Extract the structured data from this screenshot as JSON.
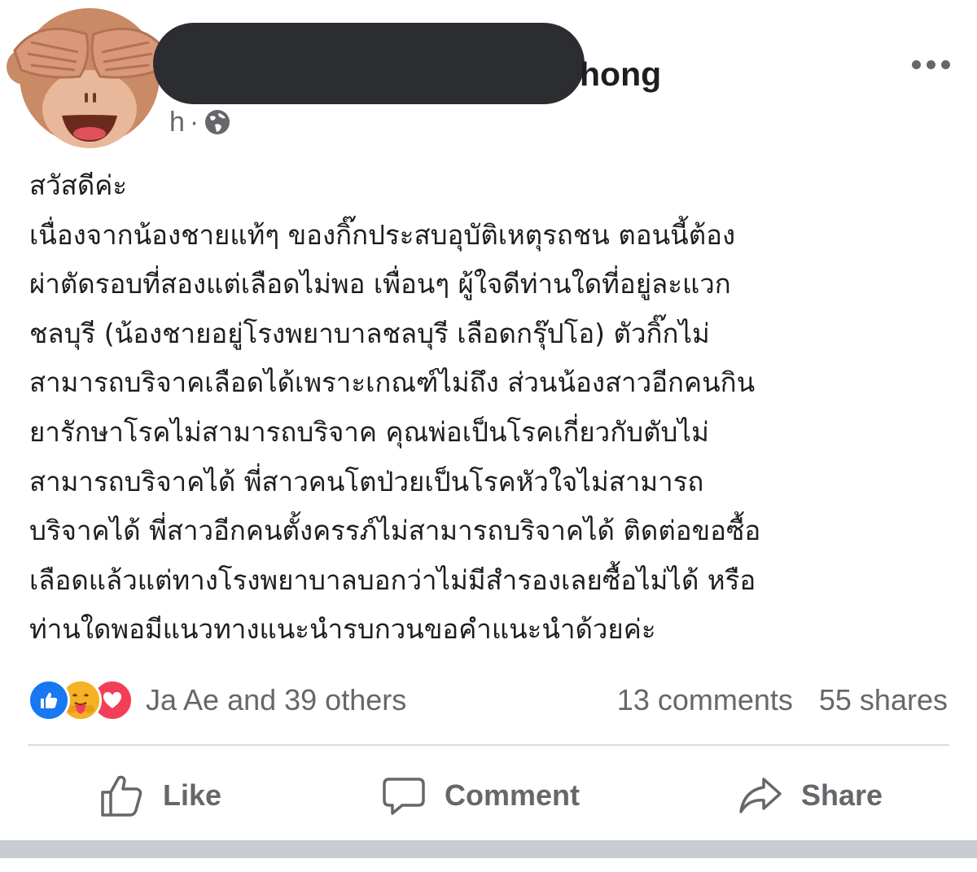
{
  "post": {
    "author_visible_suffix": "hong",
    "time_visible": "h",
    "separator": "·",
    "privacy_icon": "globe-icon",
    "more_icon": "ellipsis-icon",
    "avatar_icon": "see-no-evil-monkey-emoji",
    "body_lines": [
      "สวัสดีค่ะ",
      "เนื่องจากน้องชายแท้ๆ ของกิ๊กประสบอุบัติเหตุรถชน ตอนนี้ต้อง",
      "ผ่าตัดรอบที่สองแต่เลือดไม่พอ เพื่อนๆ ผู้ใจดีท่านใดที่อยู่ละแวก",
      "ชลบุรี (น้องชายอยู่โรงพยาบาลชลบุรี เลือดกรุ๊ปโอ) ตัวกิ๊กไม่",
      "สามารถบริจาคเลือดได้เพราะเกณฑ์ไม่ถึง ส่วนน้องสาวอีกคนกิน",
      "ยารักษาโรคไม่สามารถบริจาค คุณพ่อเป็นโรคเกี่ยวกับตับไม่",
      "สามารถบริจาคได้ พี่สาวคนโตป่วยเป็นโรคหัวใจไม่สามารถ",
      "บริจาคได้ พี่สาวอีกคนตั้งครรภ์ไม่สามารถบริจาคได้ ติดต่อขอซื้อ",
      "เลือดแล้วแต่ทางโรงพยาบาลบอกว่าไม่มีสำรองเลยซื้อไม่ได้ หรือ",
      "ท่านใดพอมีแนวทางแนะนำรบกวนขอคำแนะนำด้วยค่ะ"
    ]
  },
  "reactions": {
    "icons": [
      "like-reaction-icon",
      "care-reaction-icon",
      "love-reaction-icon"
    ],
    "summary": "Ja Ae and 39 others",
    "comments": "13 comments",
    "shares": "55 shares"
  },
  "actions": {
    "like": "Like",
    "comment": "Comment",
    "share": "Share"
  },
  "colors": {
    "like_blue": "#1877f2",
    "care_yellow": "#f7b125",
    "love_red": "#f33e58",
    "secondary_text": "#65676b"
  }
}
